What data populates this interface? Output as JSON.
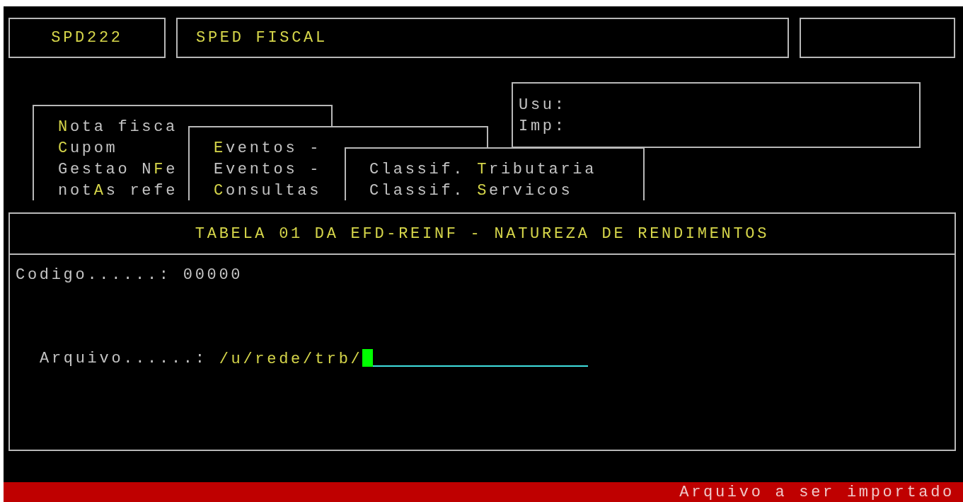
{
  "header": {
    "program_code": "SPD222",
    "program_name": "SPED FISCAL"
  },
  "session": {
    "labels": [
      "Usu:",
      "Imp:"
    ]
  },
  "menus": [
    {
      "items": [
        {
          "key": "N",
          "rest": "ota fisca"
        },
        {
          "key": "C",
          "rest": "upom"
        },
        {
          "pre": "Gestao N",
          "key": "F",
          "rest": "e"
        },
        {
          "pre": "not",
          "key": "A",
          "rest": "s refe"
        }
      ]
    },
    {
      "items": [
        {
          "key": "E",
          "rest": "ventos -"
        },
        {
          "pre": "Eventos -"
        },
        {
          "key": "C",
          "rest": "onsultas"
        }
      ]
    },
    {
      "items": [
        {
          "pre": "Classif. ",
          "key": "T",
          "rest": "ributaria"
        },
        {
          "pre": "Classif. ",
          "key": "S",
          "rest": "ervicos"
        }
      ]
    }
  ],
  "form": {
    "title": "TABELA 01 DA EFD-REINF - NATUREZA DE RENDIMENTOS",
    "code": {
      "label": "Codigo......:",
      "value": "00000"
    },
    "file": {
      "label": "Arquivo......:",
      "value": "/u/rede/trb/"
    }
  },
  "status_bar": {
    "message": "Arquivo a ser importado"
  }
}
